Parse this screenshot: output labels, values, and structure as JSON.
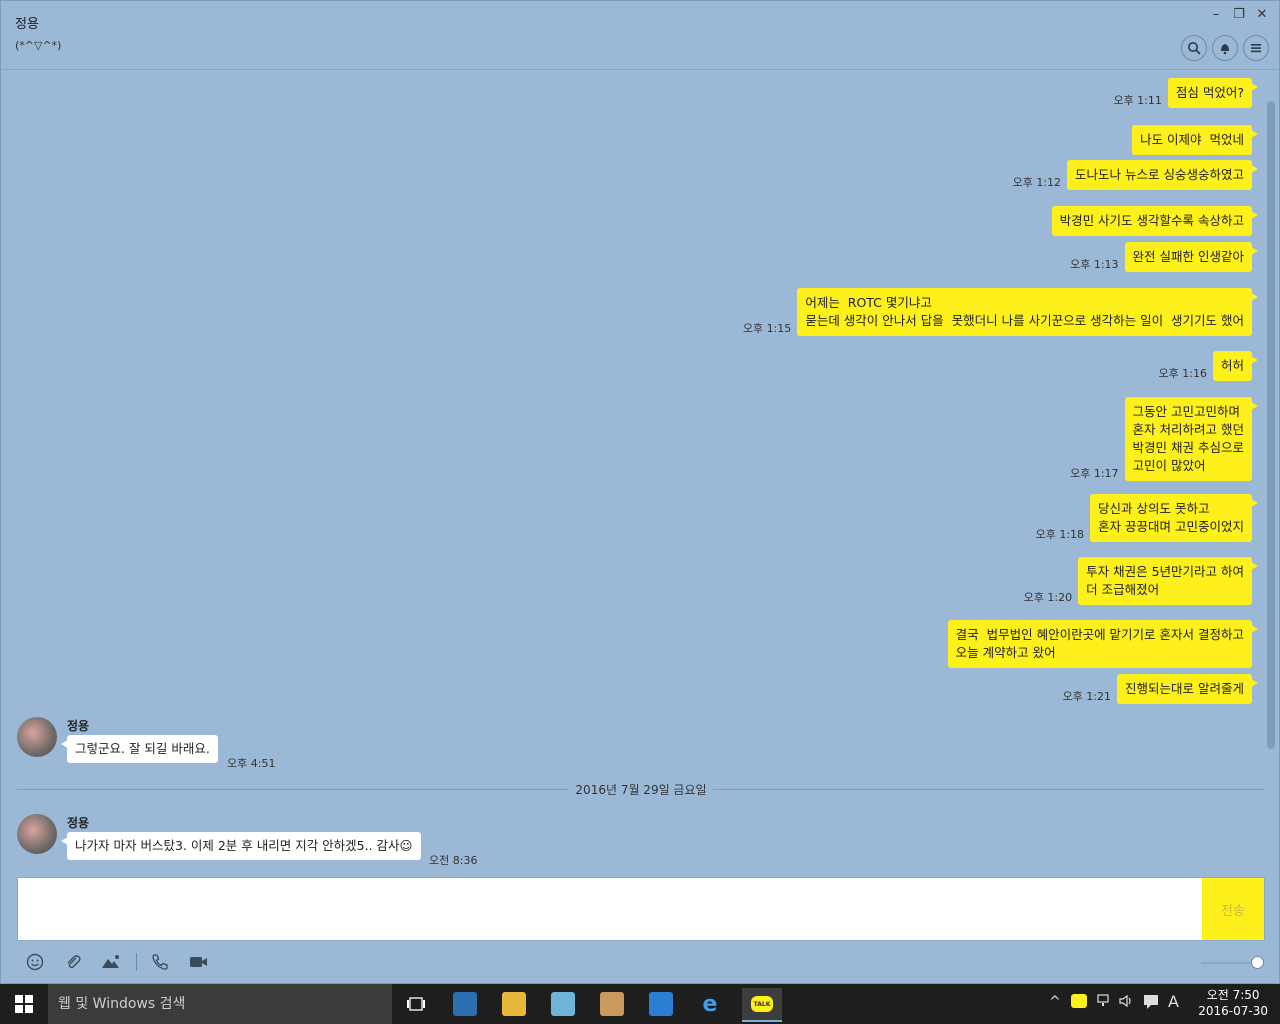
{
  "header": {
    "name": "정용",
    "status": "(*^▽^*)"
  },
  "window_controls": {
    "minimize": "–",
    "restore": "❐",
    "close": "✕"
  },
  "messages_me": [
    {
      "time": "오후 1:11",
      "text": "점심 먹었어?"
    },
    {
      "time": "",
      "text": "나도 이제야  먹었네"
    },
    {
      "time": "오후 1:12",
      "text": "도나도나 뉴스로 싱숭생숭하였고"
    },
    {
      "time": "",
      "text": "박경민 사기도 생각할수록 속상하고"
    },
    {
      "time": "오후 1:13",
      "text": "완전 실패한 인생같아"
    },
    {
      "time": "오후 1:15",
      "text": "어제는  ROTC 몇기냐고\n묻는데 생각이 안나서 답을  못했더니 나를 사기꾼으로 생각하는 일이  생기기도 했어"
    },
    {
      "time": "오후 1:16",
      "text": "허허"
    },
    {
      "time": "오후 1:17",
      "text": "그동안 고민고민하며\n혼자 처리하려고 했던\n박경민 채권 추심으로\n고민이 많았어"
    },
    {
      "time": "오후 1:18",
      "text": "당신과 상의도 못하고\n혼자 끙끙대며 고민중이었지"
    },
    {
      "time": "오후 1:20",
      "text": "투자 채권은 5년만기라고 하여\n더 조급해졌어"
    },
    {
      "time": "",
      "text": "결국  법무법인 혜안이란곳에 맡기기로 혼자서 결정하고\n오늘 계약하고 왔어"
    },
    {
      "time": "오후 1:21",
      "text": "진행되는대로 알려줄게"
    }
  ],
  "messages_other": [
    {
      "sender": "정용",
      "text": "그렇군요. 잘 되길 바래요.",
      "time": "오후 4:51"
    },
    {
      "sender": "정용",
      "text": "나가자 마자 버스탔3. 이제 2분 후 내리면 지각 안하겠5.. 감사☺",
      "time": "오전 8:36"
    }
  ],
  "date_divider": "2016년 7월 29일 금요일",
  "composer": {
    "send_label": "전송",
    "value": ""
  },
  "toolbar_icons": [
    "emoji-icon",
    "attach-icon",
    "image-icon",
    "call-icon",
    "video-icon"
  ],
  "taskbar": {
    "search_placeholder": "웹 및 Windows 검색",
    "ime_indicator": "A",
    "clock_time": "오전 7:50",
    "clock_date": "2016-07-30"
  },
  "colors": {
    "chat_bg": "#9bb9d6",
    "my_bubble": "#fef01b",
    "other_bubble": "#ffffff",
    "taskbar": "#1e1e1e"
  }
}
